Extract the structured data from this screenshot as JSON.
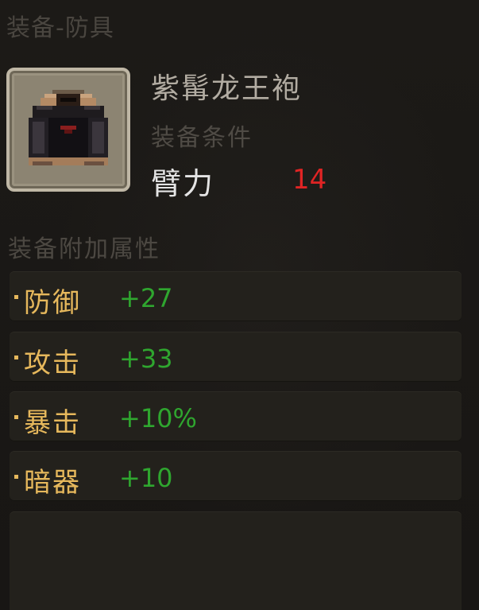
{
  "panel": {
    "title": "装备-防具"
  },
  "item": {
    "icon": "dark-robe-icon",
    "name": "紫髯龙王袍"
  },
  "requirement": {
    "label": "装备条件",
    "stat": "臂力",
    "value": "14"
  },
  "attributes": {
    "header": "装备附加属性",
    "rows": [
      {
        "name": "防御",
        "value": "+27"
      },
      {
        "name": "攻击",
        "value": "+33"
      },
      {
        "name": "暴击",
        "value": "+10%"
      },
      {
        "name": "暗器",
        "value": "+10"
      }
    ]
  },
  "colors": {
    "attribute_name": "#e6b85c",
    "attribute_value": "#2fa62f",
    "requirement_value": "#e02424"
  }
}
